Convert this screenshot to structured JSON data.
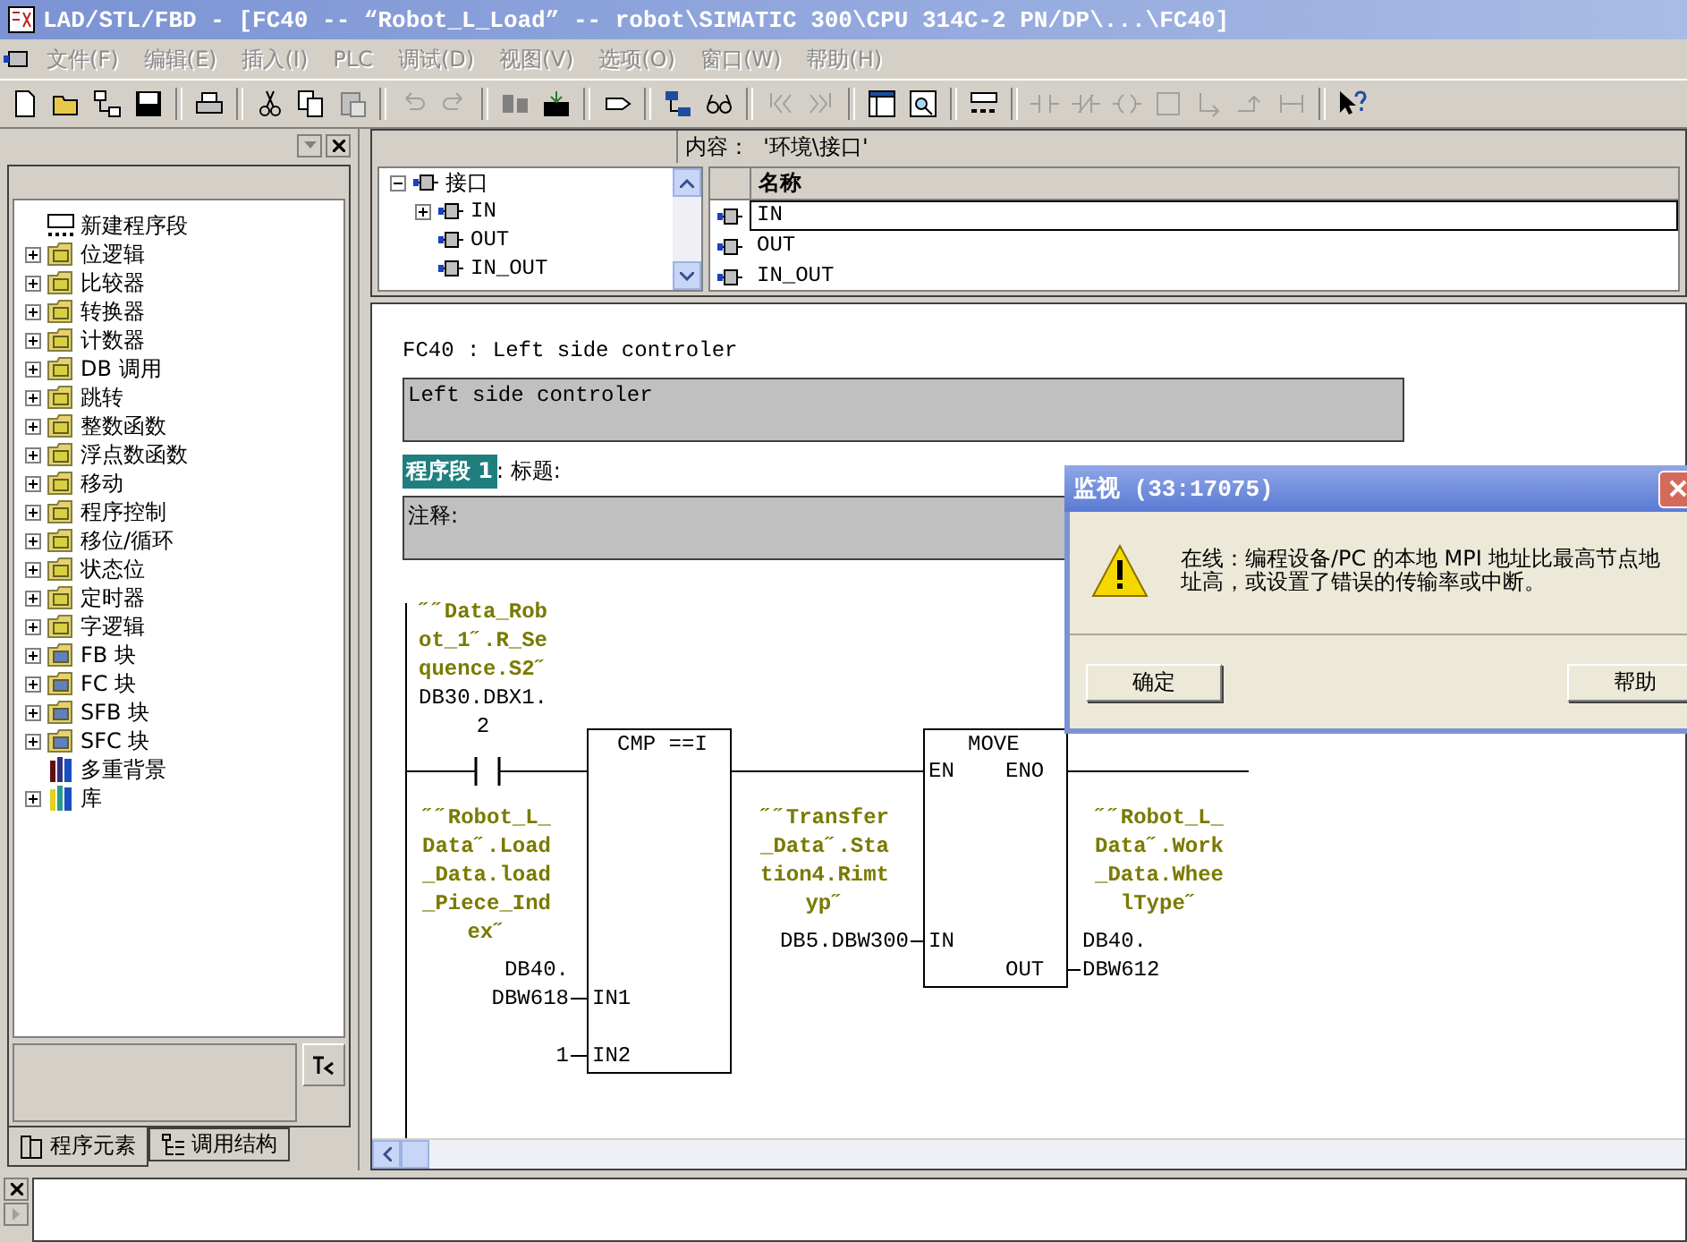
{
  "window": {
    "title": "LAD/STL/FBD  - [FC40 -- “Robot_L_Load” -- robot\\SIMATIC 300\\CPU 314C-2 PN/DP\\...\\FC40]"
  },
  "menu": [
    {
      "label": "文件(F)",
      "disabled": true
    },
    {
      "label": "编辑(E)",
      "disabled": true
    },
    {
      "label": "插入(I)",
      "disabled": true
    },
    {
      "label": "PLC",
      "disabled": true
    },
    {
      "label": "调试(D)",
      "disabled": true
    },
    {
      "label": "视图(V)",
      "disabled": true
    },
    {
      "label": "选项(O)",
      "disabled": true
    },
    {
      "label": "窗口(W)",
      "disabled": true
    },
    {
      "label": "帮助(H)",
      "disabled": true
    }
  ],
  "program_elements": {
    "items": [
      {
        "label": "新建程序段",
        "kind": "network"
      },
      {
        "label": "位逻辑",
        "kind": "folder"
      },
      {
        "label": "比较器",
        "kind": "folder"
      },
      {
        "label": "转换器",
        "kind": "folder"
      },
      {
        "label": "计数器",
        "kind": "folder"
      },
      {
        "label": "DB 调用",
        "kind": "folder"
      },
      {
        "label": "跳转",
        "kind": "folder"
      },
      {
        "label": "整数函数",
        "kind": "folder"
      },
      {
        "label": "浮点数函数",
        "kind": "folder"
      },
      {
        "label": "移动",
        "kind": "folder"
      },
      {
        "label": "程序控制",
        "kind": "folder"
      },
      {
        "label": "移位/循环",
        "kind": "folder"
      },
      {
        "label": "状态位",
        "kind": "folder"
      },
      {
        "label": "定时器",
        "kind": "folder"
      },
      {
        "label": "字逻辑",
        "kind": "folder"
      },
      {
        "label": "FB 块",
        "kind": "block"
      },
      {
        "label": "FC 块",
        "kind": "block"
      },
      {
        "label": "SFB 块",
        "kind": "block"
      },
      {
        "label": "SFC 块",
        "kind": "block"
      },
      {
        "label": "多重背景",
        "kind": "multi"
      },
      {
        "label": "库",
        "kind": "library"
      }
    ],
    "tabs": [
      {
        "label": "程序元素",
        "selected": true
      },
      {
        "label": "调用结构",
        "selected": false
      }
    ]
  },
  "interface": {
    "content_label": "内容：  '环境\\接口'",
    "tree": {
      "label": "接口",
      "kind": "group",
      "expanded": true,
      "children": [
        {
          "label": "IN",
          "kind": "group",
          "expanded": false
        },
        {
          "label": "OUT",
          "kind": "leaf"
        },
        {
          "label": "IN_OUT",
          "kind": "leaf"
        }
      ]
    },
    "table": {
      "column": "名称",
      "rows": [
        {
          "name": "IN",
          "selected": true
        },
        {
          "name": "OUT",
          "selected": false
        },
        {
          "name": "IN_OUT",
          "selected": false
        }
      ]
    }
  },
  "block": {
    "title": "FC40 : Left side controler",
    "comment": "Left side controler"
  },
  "network": {
    "label": "程序段 1",
    "selected": true,
    "title": ": 标题:",
    "comment": "注释:"
  },
  "diagram": {
    "contact": {
      "symbol": "˝˝Data_Robot_1˝.R_Sequence.S2˝",
      "address": [
        "DB30.DBX1.",
        "2"
      ]
    },
    "compare": {
      "title": "CMP ==I",
      "in1": {
        "pin": "IN1",
        "symbol": "˝˝Robot_L_Data˝.Load_Data.load_Piece_Index˝",
        "address": [
          "DB40.",
          "DBW618"
        ]
      },
      "in2": {
        "pin": "IN2",
        "address": [
          "1"
        ]
      }
    },
    "move": {
      "title": "MOVE",
      "en": "EN",
      "eno": "ENO",
      "in": {
        "pin": "IN",
        "symbol": "˝˝Transfer_Data˝.Station4.Rimtyp˝",
        "address": [
          "DB5.DBW300"
        ]
      },
      "out": {
        "pin": "OUT",
        "symbol": "˝˝Robot_L_Data˝.Work_Data.WheelType˝",
        "address": [
          "DB40.",
          "DBW612"
        ]
      }
    }
  },
  "dialog": {
    "title": "监视 (33:17075)",
    "message": "在线：编程设备/PC 的本地 MPI 地址比最高节点地址高，或设置了错误的传输率或中断。",
    "buttons": [
      "确定",
      "帮助"
    ]
  }
}
